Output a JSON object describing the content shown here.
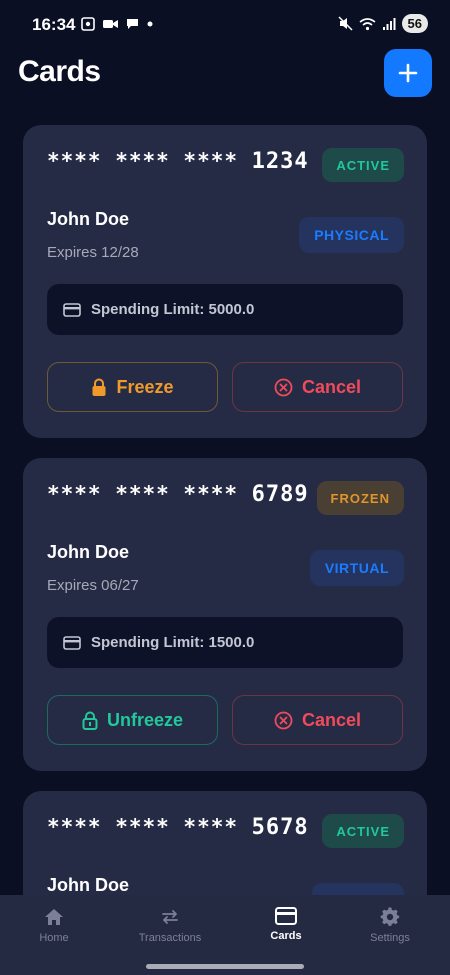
{
  "status_bar": {
    "time": "16:34",
    "battery": "56"
  },
  "header": {
    "title": "Cards"
  },
  "cards": [
    {
      "masked": "**** **** ****",
      "last4": "1234",
      "status": "ACTIVE",
      "holder": "John Doe",
      "expires": "Expires 12/28",
      "type": "PHYSICAL",
      "spending_limit": "Spending Limit: 5000.0",
      "primary_action": "Freeze",
      "cancel_action": "Cancel"
    },
    {
      "masked": "**** **** ****",
      "last4": "6789",
      "status": "FROZEN",
      "holder": "John Doe",
      "expires": "Expires 06/27",
      "type": "VIRTUAL",
      "spending_limit": "Spending Limit: 1500.0",
      "primary_action": "Unfreeze",
      "cancel_action": "Cancel"
    },
    {
      "masked": "**** **** ****",
      "last4": "5678",
      "status": "ACTIVE",
      "holder": "John Doe"
    }
  ],
  "tabs": [
    {
      "label": "Home",
      "icon": "home-icon"
    },
    {
      "label": "Transactions",
      "icon": "swap-arrows-icon"
    },
    {
      "label": "Cards",
      "icon": "card-icon",
      "active": true
    },
    {
      "label": "Settings",
      "icon": "gear-icon"
    }
  ],
  "colors": {
    "background": "#0b0f24",
    "card": "#262b45",
    "accent": "#1379ff",
    "active": "#22c79b",
    "frozen": "#e0952c",
    "danger": "#ef4b5b"
  }
}
